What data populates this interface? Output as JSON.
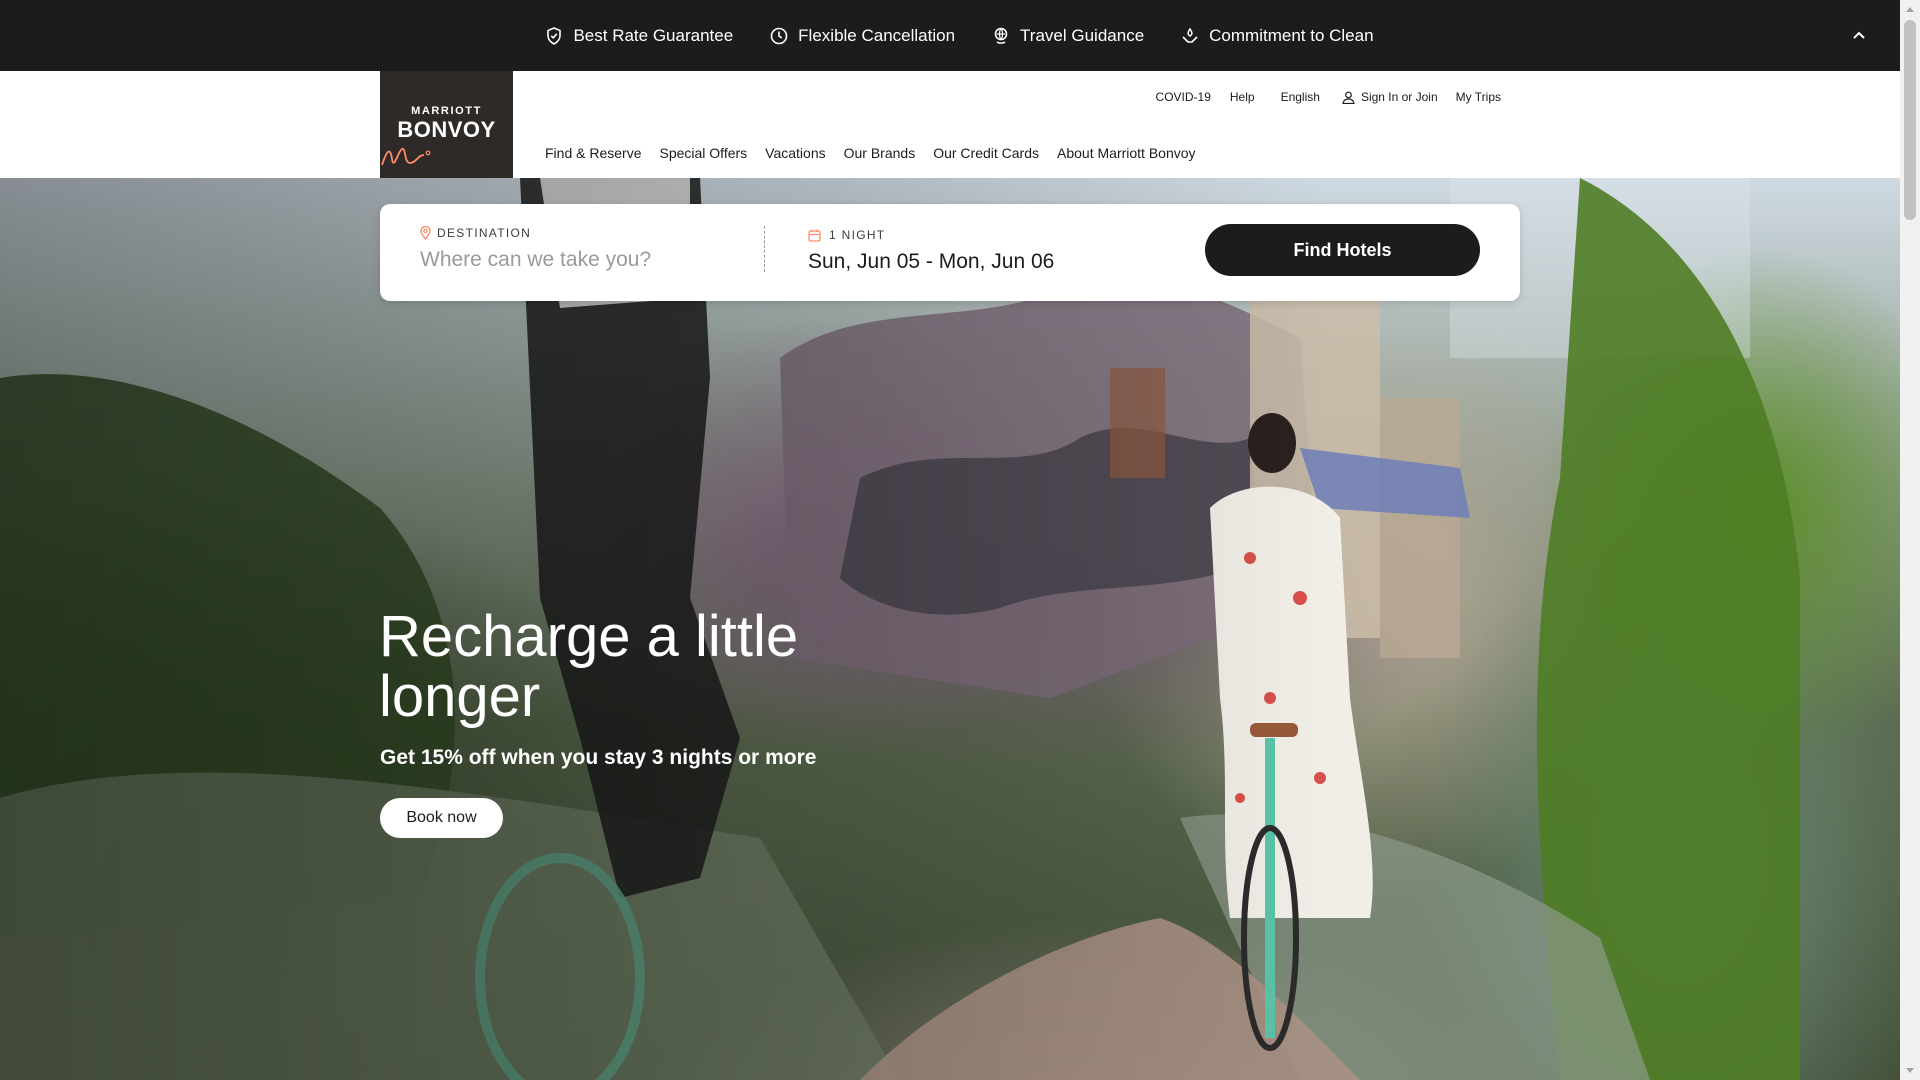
{
  "promo": {
    "items": [
      {
        "label": "Best Rate Guarantee",
        "icon": "shield-check-icon"
      },
      {
        "label": "Flexible Cancellation",
        "icon": "clock-icon"
      },
      {
        "label": "Travel Guidance",
        "icon": "globe-hand-icon"
      },
      {
        "label": "Commitment to Clean",
        "icon": "clean-hands-icon"
      }
    ]
  },
  "header": {
    "logo_line1": "MARRIOTT",
    "logo_line2": "BONVOY",
    "utility": {
      "covid": "COVID-19",
      "help": "Help",
      "language": "English",
      "sign_in": "Sign In or Join",
      "my_trips": "My Trips"
    },
    "nav": [
      "Find & Reserve",
      "Special Offers",
      "Vacations",
      "Our Brands",
      "Our Credit Cards",
      "About Marriott Bonvoy"
    ]
  },
  "search": {
    "destination_label": "DESTINATION",
    "destination_placeholder": "Where can we take you?",
    "nights_label": "1 NIGHT",
    "dates": "Sun, Jun 05 - Mon, Jun 06",
    "find_button": "Find Hotels"
  },
  "hero": {
    "title": "Recharge a little longer",
    "subtitle": "Get 15% off when you stay 3 nights or more",
    "cta": "Book now"
  },
  "colors": {
    "brand_dark": "#1c1c1c",
    "accent_orange": "#ff8d6b",
    "logo_bg": "#2e2a27"
  }
}
